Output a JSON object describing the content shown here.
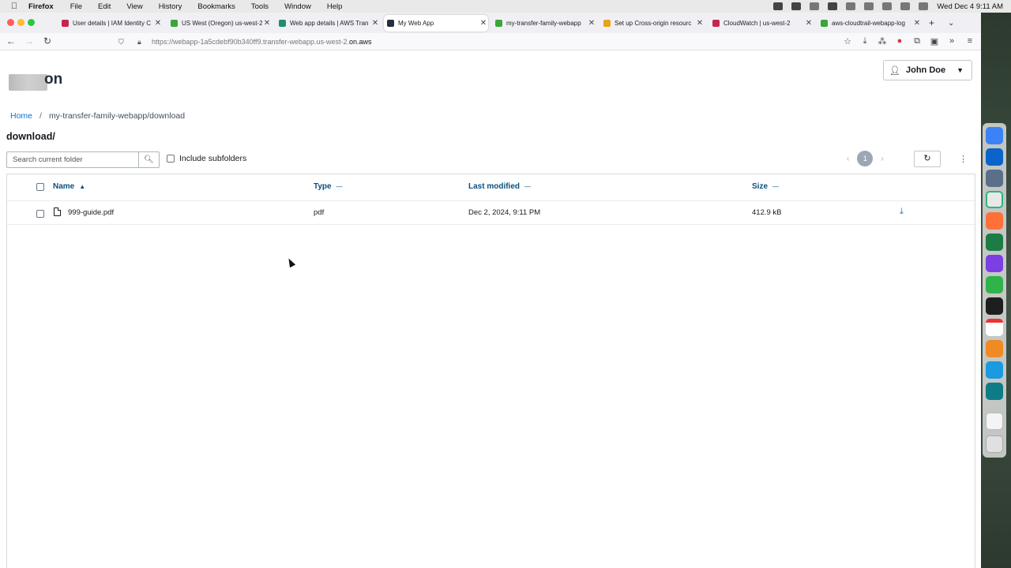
{
  "menubar": {
    "app": "Firefox",
    "items": [
      "File",
      "Edit",
      "View",
      "History",
      "Bookmarks",
      "Tools",
      "Window",
      "Help"
    ],
    "clock": "Wed Dec 4  9:11 AM"
  },
  "browser": {
    "tabs": [
      {
        "label": "User details | IAM Identity C",
        "color": "#c7254e"
      },
      {
        "label": "US West (Oregon) us-west-2",
        "color": "#3aa53a"
      },
      {
        "label": "Web app details | AWS Tran",
        "color": "#1e8f6e"
      },
      {
        "label": "My Web App",
        "color": "#232f3e",
        "active": true
      },
      {
        "label": "my-transfer-family-webapp",
        "color": "#3aa53a"
      },
      {
        "label": "Set up Cross-origin resourc",
        "color": "#e8a317"
      },
      {
        "label": "CloudWatch | us-west-2",
        "color": "#c7254e"
      },
      {
        "label": "aws-cloudtrail-webapp-log",
        "color": "#3aa53a"
      }
    ],
    "url_prefix": "https://webapp-1a5cdebf90b340ff9.transfer-webapp.us-west-2.",
    "url_domain": "on.aws"
  },
  "header": {
    "logo_text": "on",
    "user_name": "John Doe"
  },
  "breadcrumb": {
    "home": "Home",
    "separator": "/",
    "current": "my-transfer-family-webapp/download"
  },
  "page_title": "download/",
  "toolbar": {
    "search_placeholder": "Search current folder",
    "include_subfolders": "Include subfolders",
    "page_number": "1"
  },
  "table": {
    "columns": {
      "name": "Name",
      "type": "Type",
      "last_modified": "Last modified",
      "size": "Size"
    },
    "rows": [
      {
        "name": "999-guide.pdf",
        "type": "pdf",
        "last_modified": "Dec 2, 2024, 9:11 PM",
        "size": "412.9 kB"
      }
    ]
  },
  "icons": {
    "search": "search-icon",
    "refresh": "refresh-icon",
    "download": "download-icon",
    "user": "user-icon",
    "file": "file-icon"
  },
  "colors": {
    "link": "#0972d3",
    "header_text": "#0b4f7f",
    "title_text": "#16191f"
  }
}
